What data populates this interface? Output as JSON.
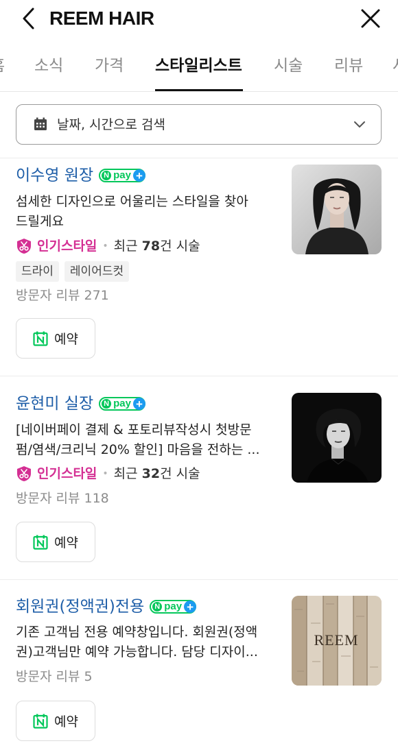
{
  "header": {
    "title": "REEM HAIR"
  },
  "tabs": [
    {
      "label": "홈"
    },
    {
      "label": "소식"
    },
    {
      "label": "가격"
    },
    {
      "label": "스타일리스트"
    },
    {
      "label": "시술"
    },
    {
      "label": "리뷰"
    },
    {
      "label": "사"
    }
  ],
  "active_tab": "스타일리스트",
  "search": {
    "label": "날짜, 시간으로 검색"
  },
  "npay_text": "pay",
  "stylists": [
    {
      "name": "이수영 원장",
      "desc_lines": [
        "섬세한 디자인으로 어울리는 스타일을 찾아",
        "드릴게요"
      ],
      "popular_label": "인기스타일",
      "recent_prefix": "최근 ",
      "recent_count": "78",
      "recent_suffix": "건 시술",
      "tags": [
        "드라이",
        "레이어드컷"
      ],
      "review": "방문자 리뷰 271",
      "reserve_label": "예약"
    },
    {
      "name": "윤현미 실장",
      "desc_lines": [
        "[네이버페이 결제 & 포토리뷰작성시 첫방문",
        "펌/염색/크리닉 20% 할인] 마음을 전하는 ..."
      ],
      "popular_label": "인기스타일",
      "recent_prefix": "최근 ",
      "recent_count": "32",
      "recent_suffix": "건 시술",
      "review": "방문자 리뷰 118",
      "reserve_label": "예약"
    },
    {
      "name": "회원권(정액권)전용",
      "desc_lines": [
        "기존 고객님 전용 예약창입니다. 회원권(정액",
        "권)고객님만 예약 가능합니다. 담당 디자이..."
      ],
      "review": "방문자 리뷰 5",
      "reserve_label": "예약",
      "photo_logo": "REEM"
    }
  ],
  "colors": {
    "name_blue": "#1e5ea8",
    "popular_pink": "#d42f93",
    "naver_green": "#03c75a",
    "npay_plus_blue": "#1c9bf0"
  }
}
